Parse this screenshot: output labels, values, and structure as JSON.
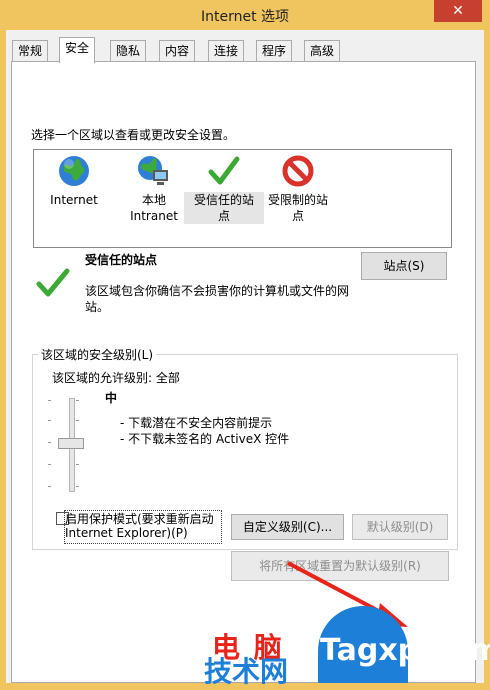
{
  "window": {
    "title": "Internet 选项",
    "close_glyph": "✕"
  },
  "tabs": [
    {
      "label": "常规"
    },
    {
      "label": "安全"
    },
    {
      "label": "隐私"
    },
    {
      "label": "内容"
    },
    {
      "label": "连接"
    },
    {
      "label": "程序"
    },
    {
      "label": "高级"
    }
  ],
  "zones": {
    "prompt": "选择一个区域以查看或更改安全设置。",
    "items": [
      {
        "line1": "Internet",
        "line2": "",
        "icon": "globe-icon"
      },
      {
        "line1": "本地",
        "line2": "Intranet",
        "icon": "local-intranet-icon"
      },
      {
        "line1": "受信任的站",
        "line2": "点",
        "icon": "green-check-icon"
      },
      {
        "line1": "受限制的站",
        "line2": "点",
        "icon": "red-block-icon"
      }
    ],
    "selected": "受信任的站点"
  },
  "zone_info": {
    "title": "受信任的站点",
    "desc1": "该区域包含你确信不会损害你的计算机或文件的网",
    "desc2": "站。",
    "sites_button": "站点(S)"
  },
  "security_level": {
    "group_label": "该区域的安全级别(L)",
    "allowed": "该区域的允许级别: 全部",
    "level": "中",
    "bullet1": "- 下载潜在不安全内容前提示",
    "bullet2": "- 不下载未签名的 ActiveX 控件",
    "protected_mode_line1": "启用保护模式(要求重新启动",
    "protected_mode_line2": "Internet Explorer)(P)",
    "protected_mode_checked": false,
    "custom_button": "自定义级别(C)...",
    "default_button": "默认级别(D)",
    "reset_all_button": "将所有区域重置为默认级别(R)"
  },
  "watermark": {
    "line1": "电 脑",
    "line2": "技术网",
    "site": "Tagxp.com"
  },
  "colors": {
    "titlebar": "#f0c560",
    "close": "#c7402f",
    "accent_check": "#3aaa35",
    "restricted": "#d9322b",
    "watermark_red": "#e8231a",
    "watermark_blue": "#1d7fd8"
  }
}
